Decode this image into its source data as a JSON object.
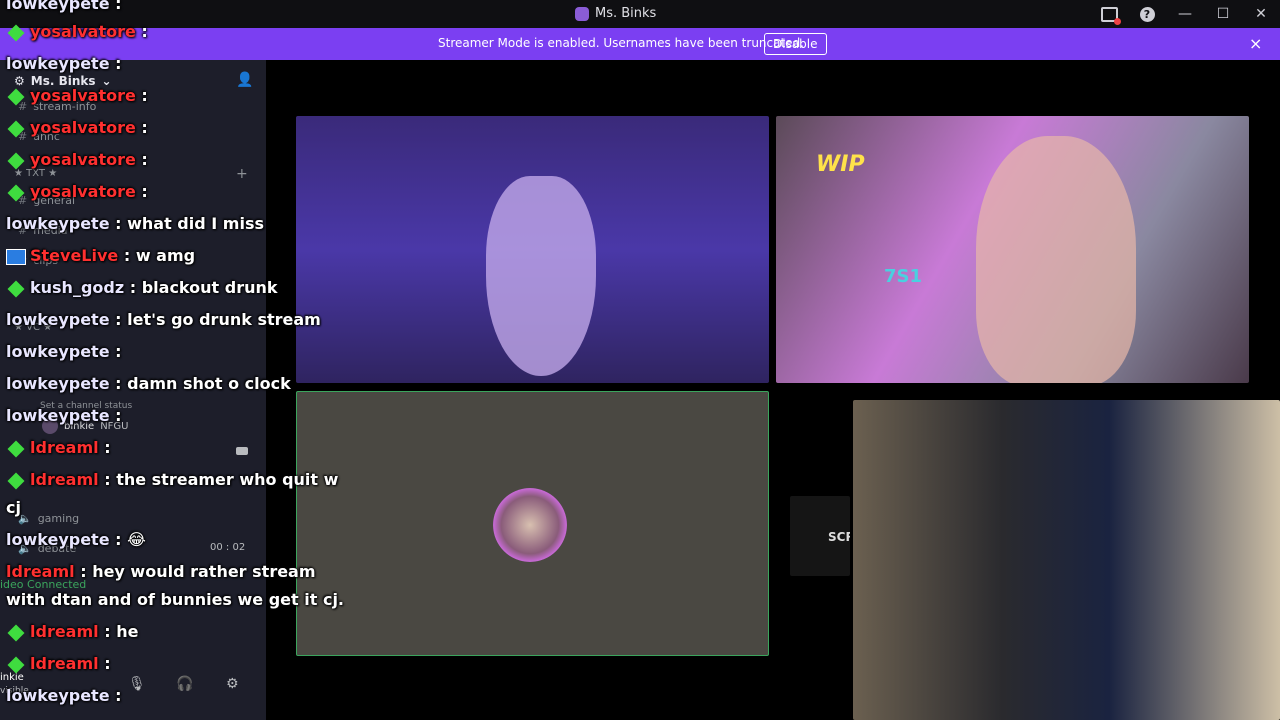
{
  "window": {
    "title": "Ms. Binks"
  },
  "banner": {
    "text": "Streamer Mode is enabled. Usernames have been truncated.",
    "disable_label": "Disable",
    "close_icon": "×"
  },
  "sidebar": {
    "server_name": "Ms. Binks",
    "channels_top": [
      "stream-info",
      "annc"
    ],
    "category_txt": "★ TXT ★",
    "channels_txt": [
      "general",
      "media",
      "clips"
    ],
    "category_vc": "★ VC ★",
    "channel_status_hint": "Set a channel status",
    "vc_user": {
      "name": "binkie",
      "tag": "NFGU"
    },
    "voice_channels": [
      "gaming",
      "debate"
    ],
    "timer": "00 : 02",
    "video_connected": "ideo Connected",
    "user_panel": {
      "name": "inkie",
      "status": "visible"
    }
  },
  "chat": [
    {
      "user": "lowkeypete",
      "color": "white",
      "text": ""
    },
    {
      "user": "yosalvatore",
      "color": "red",
      "badge": true,
      "text": ""
    },
    {
      "user": "lowkeypete",
      "color": "white",
      "text": ""
    },
    {
      "user": "yosalvatore",
      "color": "red",
      "badge": true,
      "text": ""
    },
    {
      "user": "yosalvatore",
      "color": "red",
      "badge": true,
      "text": ""
    },
    {
      "user": "yosalvatore",
      "color": "red",
      "badge": true,
      "text": ""
    },
    {
      "user": "yosalvatore",
      "color": "red",
      "badge": true,
      "text": ""
    },
    {
      "user": "lowkeypete",
      "color": "white",
      "text": "what did I miss"
    },
    {
      "user": "SteveLive",
      "color": "red",
      "sub": true,
      "text": "w amg"
    },
    {
      "user": "kush_godz",
      "color": "white",
      "badge": true,
      "text": "blackout drunk"
    },
    {
      "user": "lowkeypete",
      "color": "white",
      "text": "let's go drunk stream"
    },
    {
      "user": "lowkeypete",
      "color": "white",
      "text": ""
    },
    {
      "user": "lowkeypete",
      "color": "white",
      "text": "damn shot o clock"
    },
    {
      "user": "lowkeypete",
      "color": "white",
      "text": ""
    },
    {
      "user": "ldreaml",
      "color": "red",
      "badge": true,
      "text": ""
    },
    {
      "user": "ldreaml",
      "color": "red",
      "badge": true,
      "text": "the streamer who quit w"
    },
    {
      "user": "",
      "color": "white",
      "text": "cj"
    },
    {
      "user": "lowkeypete",
      "color": "white",
      "text": "😂"
    },
    {
      "user": "ldreaml",
      "color": "red",
      "text": "hey would rather stream"
    },
    {
      "user": "",
      "color": "white",
      "text": "with dtan and of bunnies we get it cj."
    },
    {
      "user": "ldreaml",
      "color": "red",
      "badge": true,
      "text": "he"
    },
    {
      "user": "ldreaml",
      "color": "red",
      "badge": true,
      "text": ""
    },
    {
      "user": "lowkeypete",
      "color": "white",
      "text": ""
    }
  ],
  "tiles": {
    "wip_logo": "WIP",
    "mic_logo": "7S1",
    "side_text": "SCR"
  }
}
